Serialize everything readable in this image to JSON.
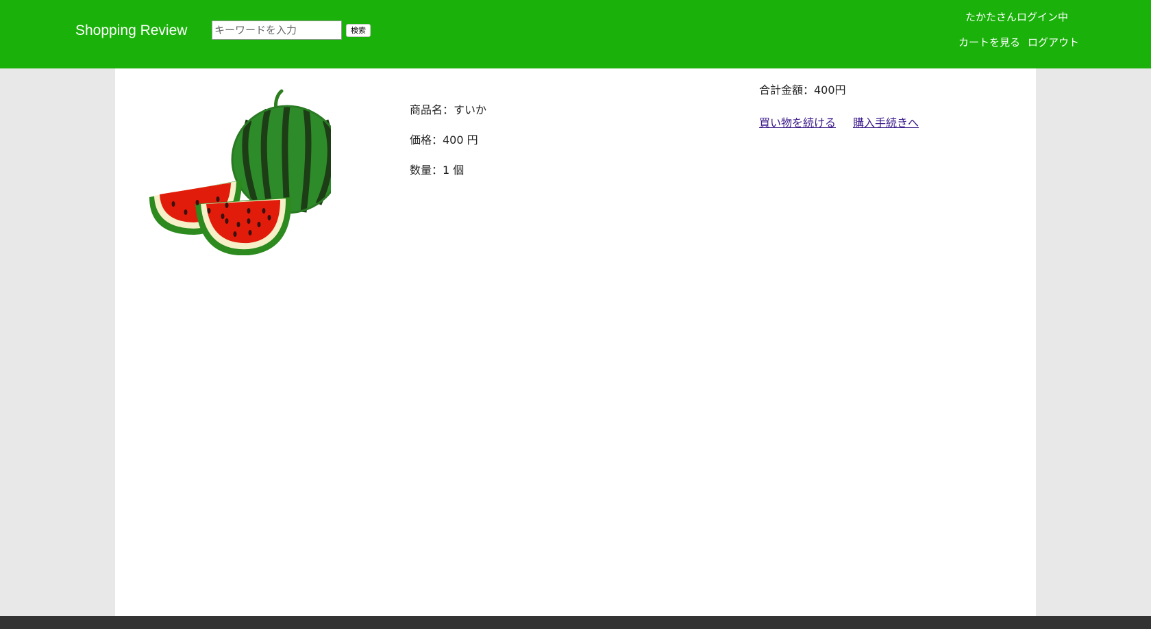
{
  "header": {
    "site_title": "Shopping Review",
    "search_placeholder": "キーワードを入力",
    "search_button": "検索",
    "user_status": "たかたさんログイン中",
    "cart_link": "カートを見る",
    "logout_link": "ログアウト"
  },
  "product": {
    "name_line": "商品名：すいか",
    "price_line": "価格：400 円",
    "quantity_line": "数量：1 個"
  },
  "summary": {
    "total_line": "合計金額：400円",
    "continue_link": "買い物を続ける",
    "checkout_link": "購入手続きへ"
  },
  "colors": {
    "header_bg": "#1ab20a",
    "link": "#3b1a8a",
    "footer_bg": "#333333"
  }
}
